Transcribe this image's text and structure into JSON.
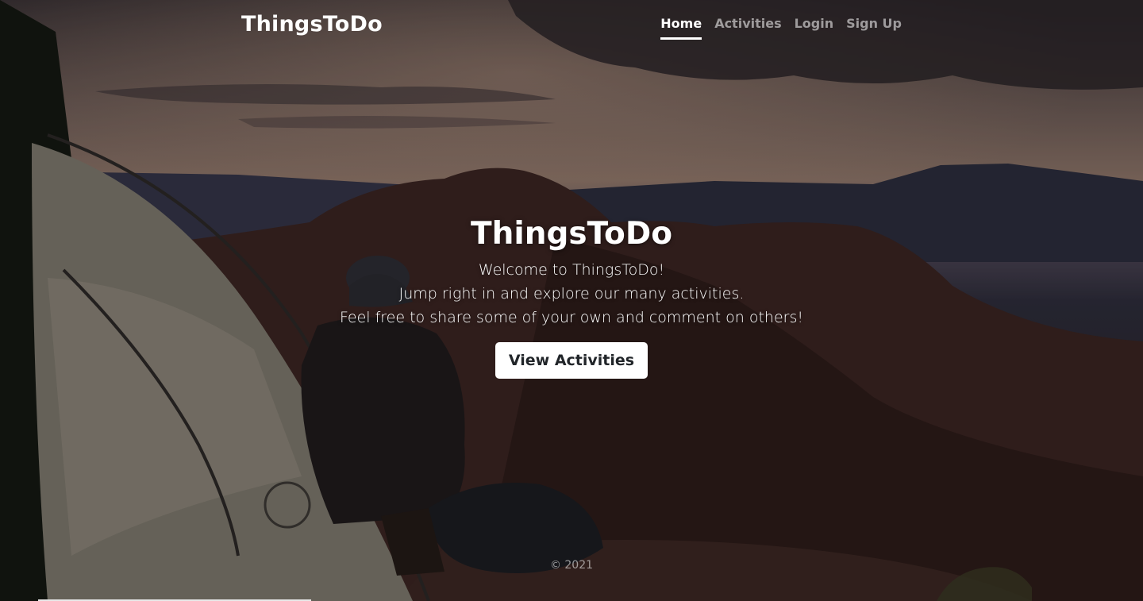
{
  "navbar": {
    "brand": "ThingsToDo",
    "links": [
      {
        "label": "Home",
        "active": true
      },
      {
        "label": "Activities",
        "active": false
      },
      {
        "label": "Login",
        "active": false
      },
      {
        "label": "Sign Up",
        "active": false
      }
    ]
  },
  "hero": {
    "title": "ThingsToDo",
    "lines": [
      "Welcome to ThingsToDo!",
      "Jump right in and explore our many activities.",
      "Feel free to share some of your own and comment on others!"
    ],
    "button_label": "View Activities"
  },
  "footer": {
    "copyright": "© 2021"
  },
  "colors": {
    "button_bg": "#ffffff",
    "button_text": "#212529",
    "nav_inactive": "rgba(255,255,255,0.55)"
  }
}
